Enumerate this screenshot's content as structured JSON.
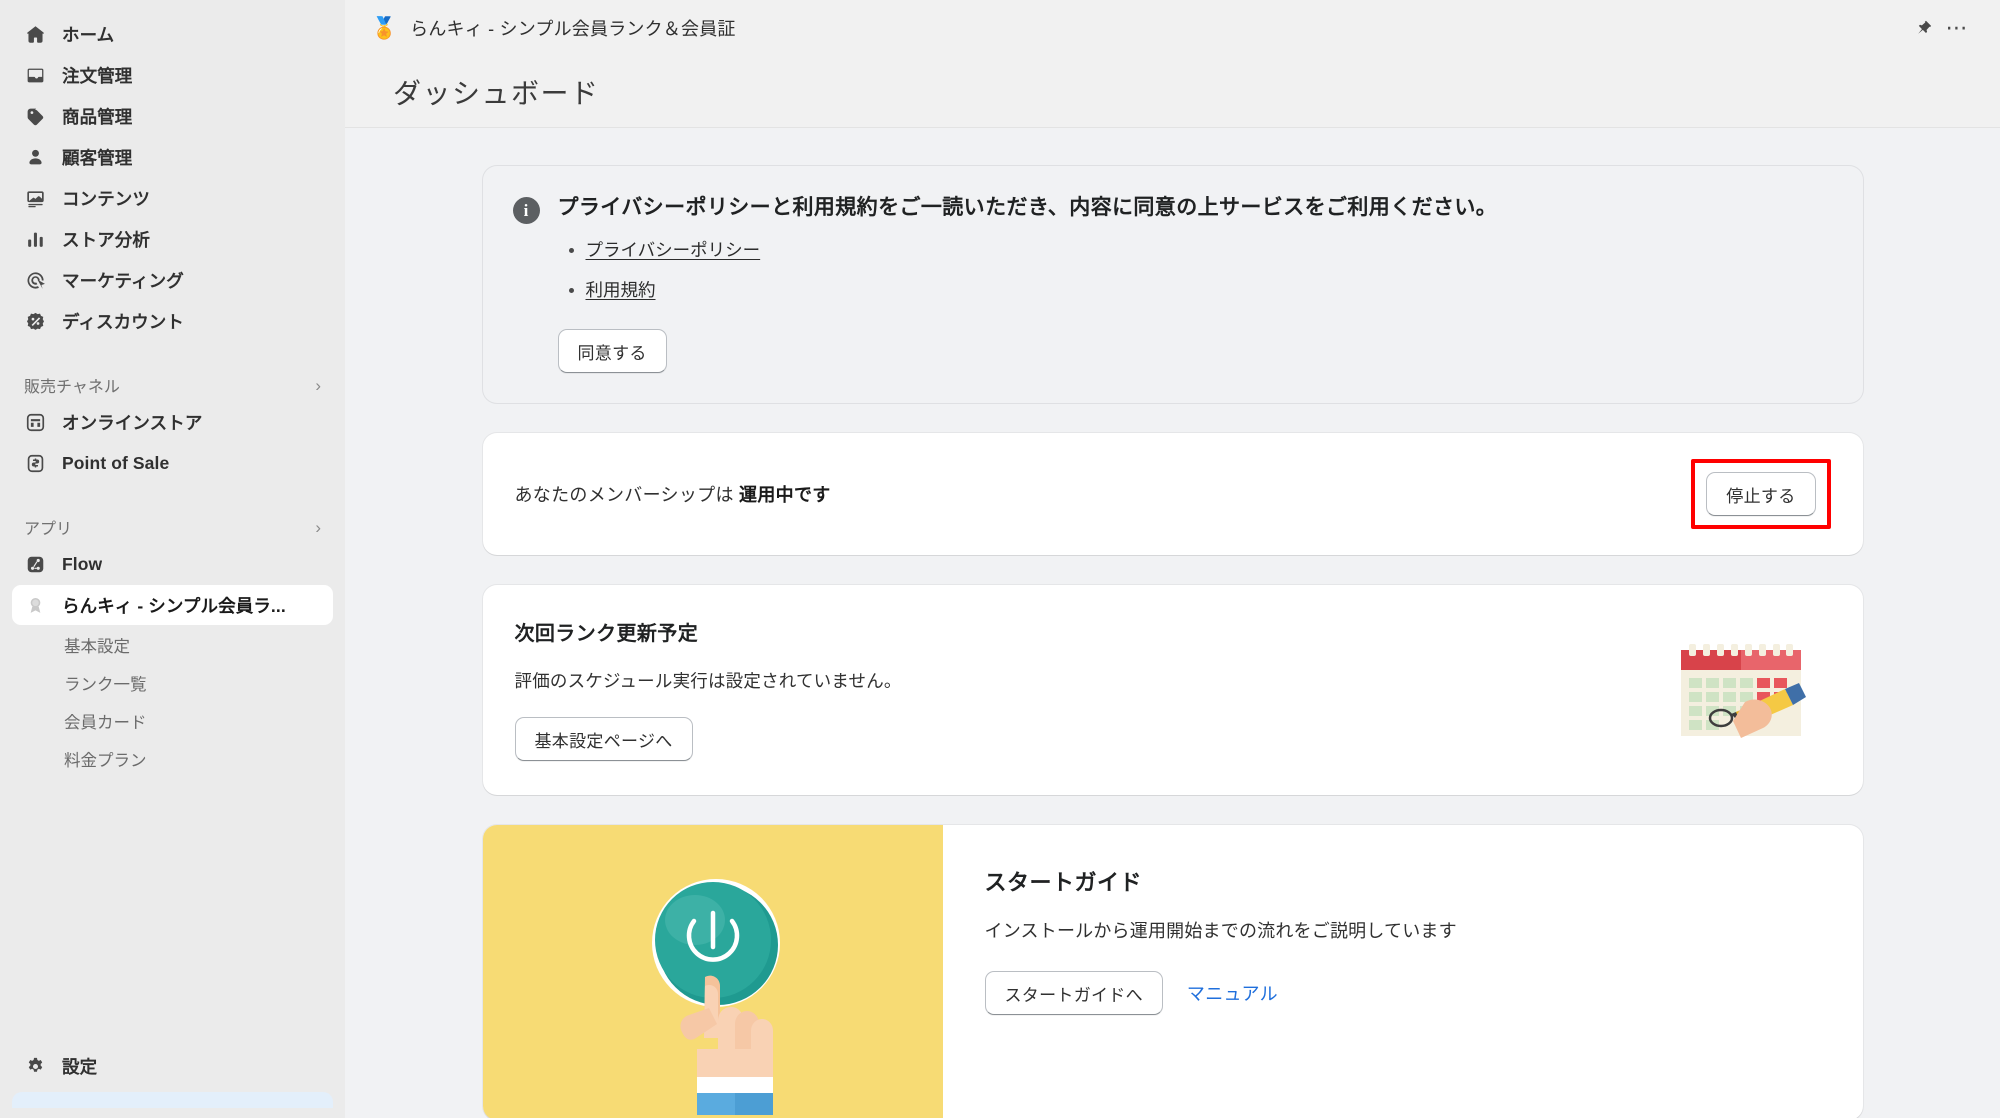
{
  "sidebar": {
    "primary": [
      {
        "label": "ホーム",
        "icon": "home-icon"
      },
      {
        "label": "注文管理",
        "icon": "orders-inbox-icon"
      },
      {
        "label": "商品管理",
        "icon": "product-tag-icon"
      },
      {
        "label": "顧客管理",
        "icon": "customer-person-icon"
      },
      {
        "label": "コンテンツ",
        "icon": "content-image-icon"
      },
      {
        "label": "ストア分析",
        "icon": "analytics-bar-icon"
      },
      {
        "label": "マーケティング",
        "icon": "marketing-target-icon"
      },
      {
        "label": "ディスカウント",
        "icon": "discount-percent-icon"
      }
    ],
    "sales_channel": {
      "title": "販売チャネル",
      "items": [
        {
          "label": "オンラインストア",
          "icon": "online-store-icon"
        },
        {
          "label": "Point of Sale",
          "icon": "point-of-sale-icon"
        }
      ]
    },
    "apps": {
      "title": "アプリ",
      "items": [
        {
          "label": "Flow",
          "icon": "flow-app-icon"
        },
        {
          "label": "らんキィ - シンプル会員ラ...",
          "icon": "rankey-app-icon",
          "active": true
        }
      ],
      "sub_items": [
        {
          "label": "基本設定"
        },
        {
          "label": "ランク一覧"
        },
        {
          "label": "会員カード"
        },
        {
          "label": "料金プラン"
        }
      ]
    },
    "settings": {
      "label": "設定",
      "icon": "gear-icon"
    }
  },
  "topbar": {
    "app_icon": "🏅",
    "title": "らんキィ - シンプル会員ランク＆会員証",
    "pin_label": "ピン留め",
    "more_label": "その他"
  },
  "page": {
    "title": "ダッシュボード"
  },
  "banner": {
    "icon": "info-icon",
    "title": "プライバシーポリシーと利用規約をご一読いただき、内容に同意の上サービスをご利用ください。",
    "links": [
      {
        "label": "プライバシーポリシー"
      },
      {
        "label": "利用規約"
      }
    ],
    "agree_button": "同意する"
  },
  "membership": {
    "text_prefix": "あなたのメンバーシップは ",
    "status": "運用中です",
    "stop_button": "停止する",
    "highlight_color": "#ff0000"
  },
  "next_rank": {
    "title": "次回ランク更新予定",
    "description": "評価のスケジュール実行は設定されていません。",
    "button": "基本設定ページへ",
    "illustration": "calendar-hand-pencil-illustration"
  },
  "start_guide": {
    "title": "スタートガイド",
    "description": "インストールから運用開始までの流れをご説明しています",
    "button": "スタートガイドへ",
    "link": "マニュアル",
    "illustration": "power-button-hand-illustration",
    "panel_color": "#f7db74",
    "button_color": "#2aa79b",
    "link_color": "#1f6fdc"
  }
}
